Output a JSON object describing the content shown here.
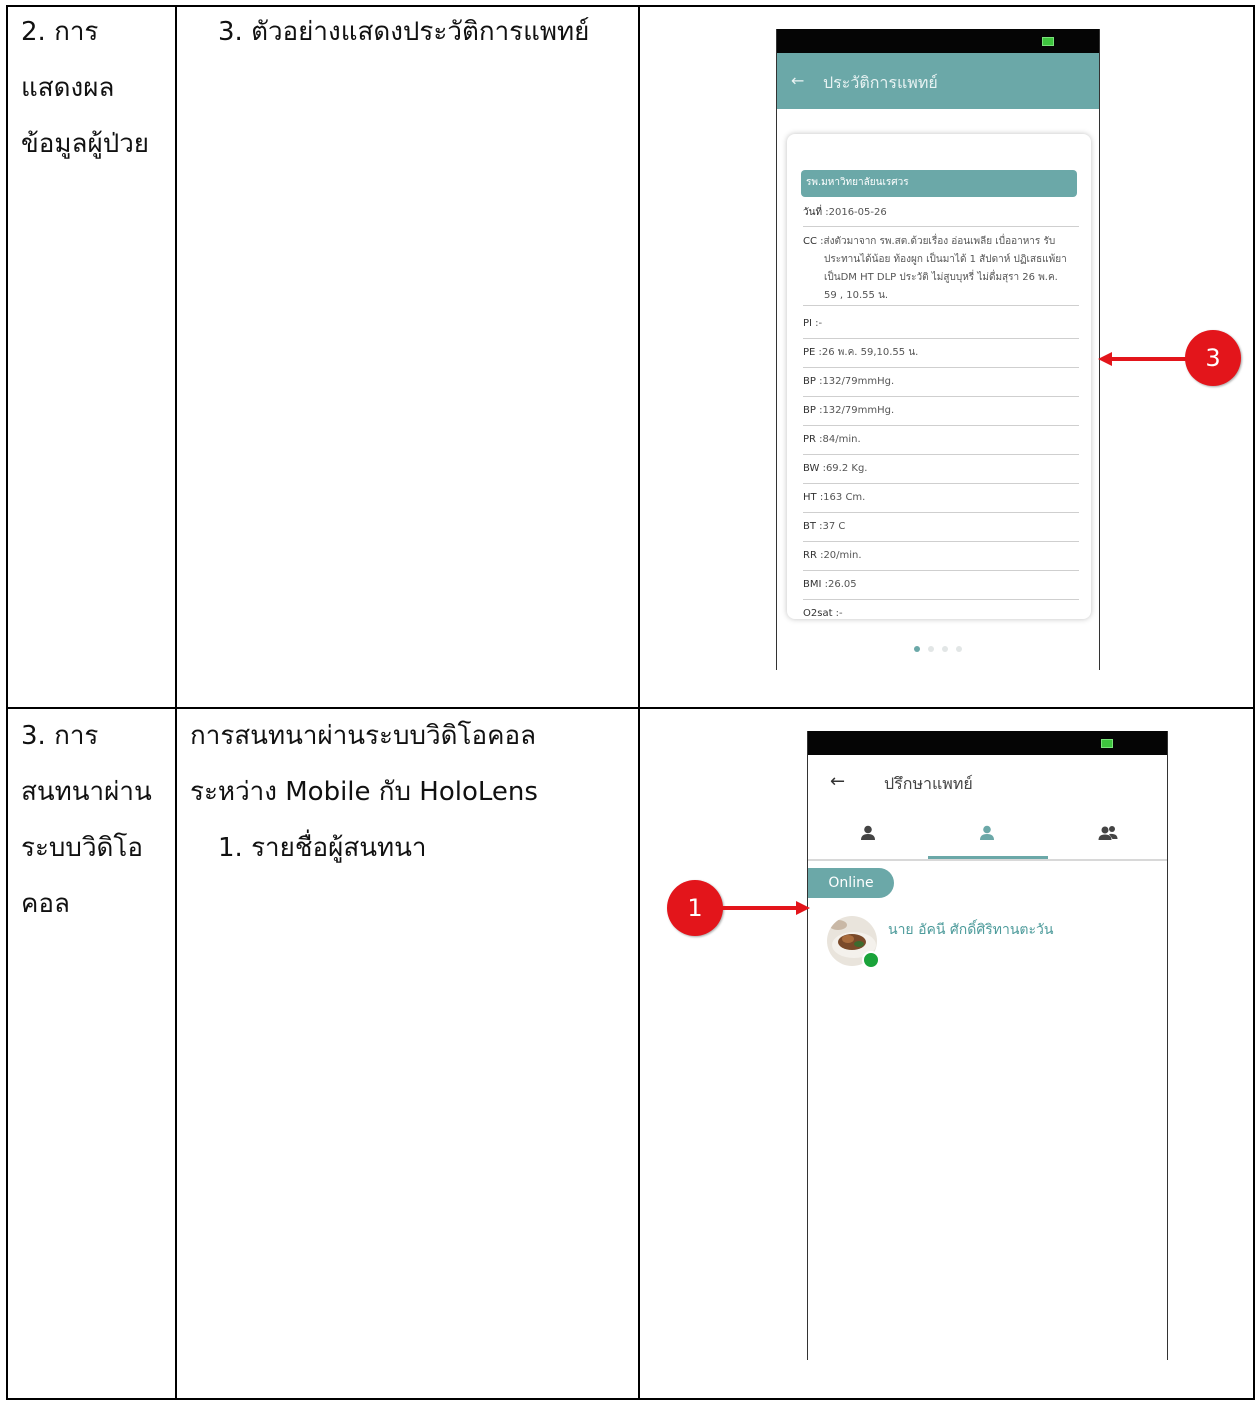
{
  "row1": {
    "col1": [
      "2. การ",
      "แสดงผล",
      "ข้อมูลผู้ป่วย"
    ],
    "col2": "3. ตัวอย่างแสดงประวัติการแพทย์",
    "phone": {
      "back_icon": "arrow-left-icon",
      "title": "ประวัติการแพทย์",
      "hospital": "รพ.มหาวิทยาลัยนเรศวร",
      "date_label": "วันที่",
      "date_value": ":2016-05-26",
      "cc_label": "CC",
      "cc_lines": [
        ":ส่งตัวมาจาก รพ.สต.ด้วยเรื่อง อ่อนเพลีย เบื่ออาหาร รับ",
        "ประทานได้น้อย ท้องผูก เป็นมาได้ 1 สัปดาห์ ปฏิเสธแพ้ยา",
        "เป็นDM HT DLP ประวัติ ไม่สูบบุหรี่ ไม่ดื่มสุรา 26 พ.ค.",
        "59 , 10.55 น."
      ],
      "records": [
        {
          "k": "PI",
          "v": ":-"
        },
        {
          "k": "PE",
          "v": ":26 พ.ค. 59,10.55 น."
        },
        {
          "k": "BP",
          "v": ":132/79mmHg."
        },
        {
          "k": "BP",
          "v": ":132/79mmHg."
        },
        {
          "k": "PR",
          "v": ":84/min."
        },
        {
          "k": "BW",
          "v": ":69.2 Kg."
        },
        {
          "k": "HT",
          "v": ":163 Cm."
        },
        {
          "k": "BT",
          "v": ":37 C"
        },
        {
          "k": "RR",
          "v": ":20/min."
        },
        {
          "k": "BMI",
          "v": ":26.05"
        },
        {
          "k": "O2sat",
          "v": ":-"
        }
      ],
      "page_count": 4,
      "active_page": 1
    },
    "annotation": "3"
  },
  "row2": {
    "col1": [
      "3. การ",
      "สนทนาผ่าน",
      "ระบบวิดิโอ",
      "คอล"
    ],
    "col2": [
      "การสนทนาผ่านระบบวิดิโอคอล",
      "ระหว่าง Mobile กับ HoloLens",
      "1. รายชื่อผู้สนทนา"
    ],
    "phone": {
      "back_icon": "arrow-left-icon",
      "title": "ปรึกษาแพทย์",
      "tabs": [
        "person-icon",
        "person-icon",
        "group-icon"
      ],
      "active_tab": 1,
      "online_label": "Online",
      "contact_name": "นาย อัคนี ศักดิ์ศิริทานตะวัน",
      "status": "online"
    },
    "annotation": "1"
  },
  "colors": {
    "accent": "#6ba8a8",
    "annotation": "#e3151b",
    "online_dot": "#1aa33a"
  }
}
